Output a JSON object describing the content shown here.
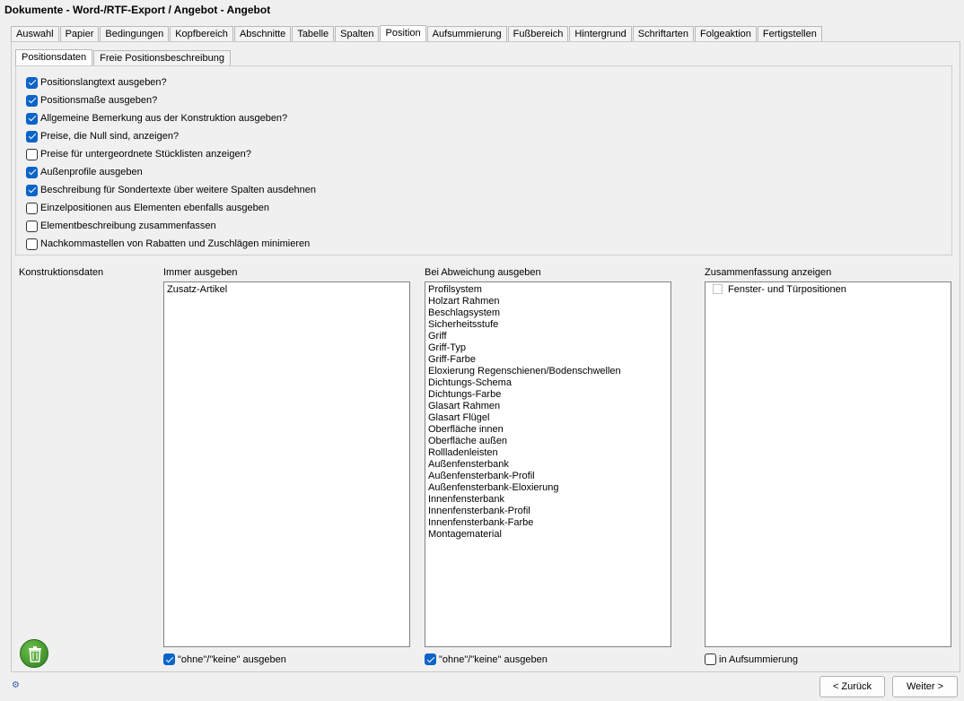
{
  "window": {
    "title": "Dokumente - Word-/RTF-Export  /  Angebot - Angebot"
  },
  "tabs": [
    "Auswahl",
    "Papier",
    "Bedingungen",
    "Kopfbereich",
    "Abschnitte",
    "Tabelle",
    "Spalten",
    "Position",
    "Aufsummierung",
    "Fußbereich",
    "Hintergrund",
    "Schriftarten",
    "Folgeaktion",
    "Fertigstellen"
  ],
  "active_tab": "Position",
  "subtabs": [
    "Positionsdaten",
    "Freie Positionsbeschreibung"
  ],
  "active_subtab": "Positionsdaten",
  "options": [
    {
      "label": "Positionslangtext ausgeben?",
      "checked": true
    },
    {
      "label": "Positionsmaße ausgeben?",
      "checked": true
    },
    {
      "label": "Allgemeine Bemerkung aus der Konstruktion ausgeben?",
      "checked": true
    },
    {
      "label": "Preise, die Null sind, anzeigen?",
      "checked": true
    },
    {
      "label": "Preise für untergeordnete Stücklisten anzeigen?",
      "checked": false
    },
    {
      "label": "Außenprofile ausgeben",
      "checked": true
    },
    {
      "label": "Beschreibung für Sondertexte über weitere Spalten ausdehnen",
      "checked": true
    },
    {
      "label": "Einzelpositionen aus Elementen ebenfalls ausgeben",
      "checked": false
    },
    {
      "label": "Elementbeschreibung zusammenfassen",
      "checked": false
    },
    {
      "label": "Nachkommastellen von Rabatten und Zuschlägen minimieren",
      "checked": false
    }
  ],
  "konstruktion": {
    "label": "Konstruktionsdaten",
    "immer": {
      "header": "Immer ausgeben",
      "items": [
        "Zusatz-Artikel"
      ],
      "checkbox_label": "\"ohne\"/\"keine\" ausgeben",
      "checkbox_checked": true
    },
    "abweichung": {
      "header": "Bei Abweichung ausgeben",
      "items": [
        "Profilsystem",
        "Holzart Rahmen",
        "Beschlagsystem",
        "Sicherheitsstufe",
        "Griff",
        "Griff-Typ",
        "Griff-Farbe",
        "Eloxierung Regenschienen/Bodenschwellen",
        "Dichtungs-Schema",
        "Dichtungs-Farbe",
        "Glasart Rahmen",
        "Glasart Flügel",
        "Oberfläche innen",
        "Oberfläche außen",
        "Rollladenleisten",
        "Außenfensterbank",
        "Außenfensterbank-Profil",
        "Außenfensterbank-Eloxierung",
        "Innenfensterbank",
        "Innenfensterbank-Profil",
        "Innenfensterbank-Farbe",
        "Montagematerial"
      ],
      "checkbox_label": "\"ohne\"/\"keine\" ausgeben",
      "checkbox_checked": true
    },
    "zusammenfassung": {
      "header": "Zusammenfassung anzeigen",
      "items": [
        {
          "label": "Fenster- und Türpositionen",
          "checked": false
        }
      ],
      "checkbox_label": "in Aufsummierung",
      "checkbox_checked": false
    }
  },
  "buttons": {
    "back": "< Zurück",
    "next": "Weiter >"
  },
  "icons": {
    "trash": "trash-icon",
    "app": "app-icon"
  },
  "colors": {
    "checkbox_accent": "#0a64c8",
    "trash_green": "#3a9a28"
  }
}
